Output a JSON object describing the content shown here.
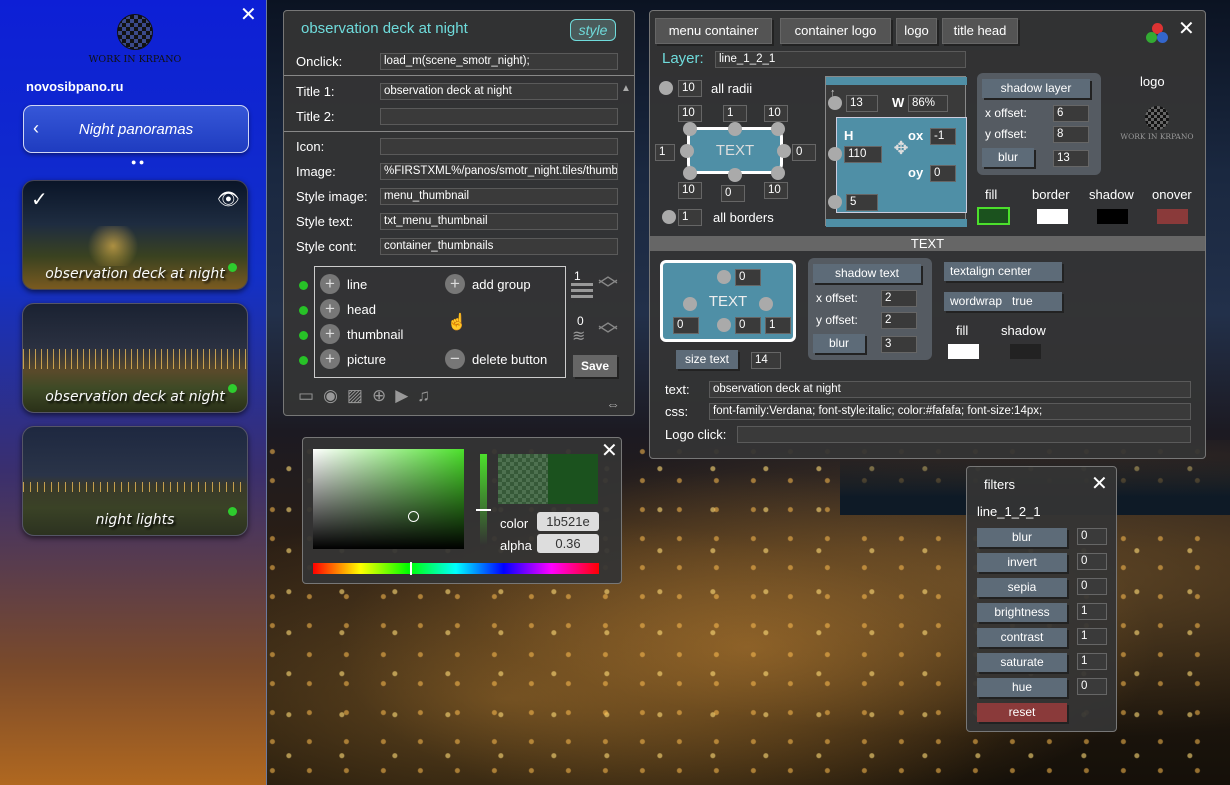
{
  "sidebar": {
    "site": "novosibpano.ru",
    "logo_text": "WORK IN KRPANO",
    "nav_title": "Night panoramas",
    "thumbs": [
      {
        "caption": "observation deck at night"
      },
      {
        "caption": "observation deck at night"
      },
      {
        "caption": "night lights"
      }
    ]
  },
  "editor": {
    "title": "observation deck at night",
    "style_badge": "style",
    "onclick_label": "Onclick:",
    "onclick_value": "load_m(scene_smotr_night);",
    "title1_label": "Title 1:",
    "title1_value": "observation deck at night",
    "title2_label": "Title 2:",
    "title2_value": "",
    "icon_label": "Icon:",
    "icon_value": "",
    "image_label": "Image:",
    "image_value": "%FIRSTXML%/panos/smotr_night.tiles/thumb.jpg",
    "style_image_label": "Style image:",
    "style_image_value": "menu_thumbnail",
    "style_text_label": "Style text:",
    "style_text_value": "txt_menu_thumbnail",
    "style_cont_label": "Style cont:",
    "style_cont_value": "container_thumbnails",
    "items": [
      "line",
      "head",
      "thumbnail",
      "picture"
    ],
    "add_group": "add group",
    "delete_button": "delete button",
    "counter1": "1",
    "counter2": "0",
    "save": "Save"
  },
  "style_panel": {
    "tabs": [
      "menu container",
      "container logo",
      "logo",
      "title head"
    ],
    "layer_label": "Layer:",
    "layer_value": "line_1_2_1",
    "all_radii": "all radii",
    "radii_value": "10",
    "corners": [
      "10",
      "1",
      "10",
      "1",
      "0",
      "10",
      "0",
      "10"
    ],
    "all_borders": "all borders",
    "borders_value": "1",
    "box_text": "TEXT",
    "top_val": "13",
    "w_label": "W",
    "w_val": "86%",
    "h_label": "H",
    "h_val": "110",
    "ox_label": "ox",
    "ox_val": "-1",
    "oy_label": "oy",
    "oy_val": "0",
    "bottom_val": "5",
    "shadow_layer": "shadow layer",
    "x_offset": "x offset:",
    "x_offset_val": "6",
    "y_offset": "y offset:",
    "y_offset_val": "8",
    "blur": "blur",
    "blur_val": "13",
    "logo_label": "logo",
    "color_labels": [
      "fill",
      "border",
      "shadow",
      "onover"
    ],
    "colors": {
      "fill": "#1b521e",
      "border": "#ffffff",
      "shadow": "#000000",
      "onover": "#8a3a3a"
    },
    "text_section": "TEXT",
    "text_box": "TEXT",
    "t_top": "0",
    "t_left": "0",
    "t_mid": "0",
    "t_right": "1",
    "size_text": "size text",
    "size_val": "14",
    "shadow_text": "shadow text",
    "st_x_label": "x offset:",
    "st_x": "2",
    "st_y_label": "y offset:",
    "st_y": "2",
    "st_blur": "blur",
    "st_blur_val": "3",
    "textalign": "textalign center",
    "wordwrap": "wordwrap   true",
    "fill": "fill",
    "shadow": "shadow",
    "text_label": "text:",
    "text_value": "observation deck at night",
    "css_label": "css:",
    "css_value": "font-family:Verdana; font-style:italic; color:#fafafa; font-size:14px;",
    "logo_click": "Logo click:",
    "logo_click_value": ""
  },
  "color_picker": {
    "color_label": "color",
    "color_value": "1b521e",
    "alpha_label": "alpha",
    "alpha_value": "0.36"
  },
  "filters": {
    "title": "filters",
    "layer": "line_1_2_1",
    "items": [
      {
        "label": "blur",
        "value": "0"
      },
      {
        "label": "invert",
        "value": "0"
      },
      {
        "label": "sepia",
        "value": "0"
      },
      {
        "label": "brightness",
        "value": "1"
      },
      {
        "label": "contrast",
        "value": "1"
      },
      {
        "label": "saturate",
        "value": "1"
      },
      {
        "label": "hue",
        "value": "0"
      }
    ],
    "reset": "reset"
  }
}
